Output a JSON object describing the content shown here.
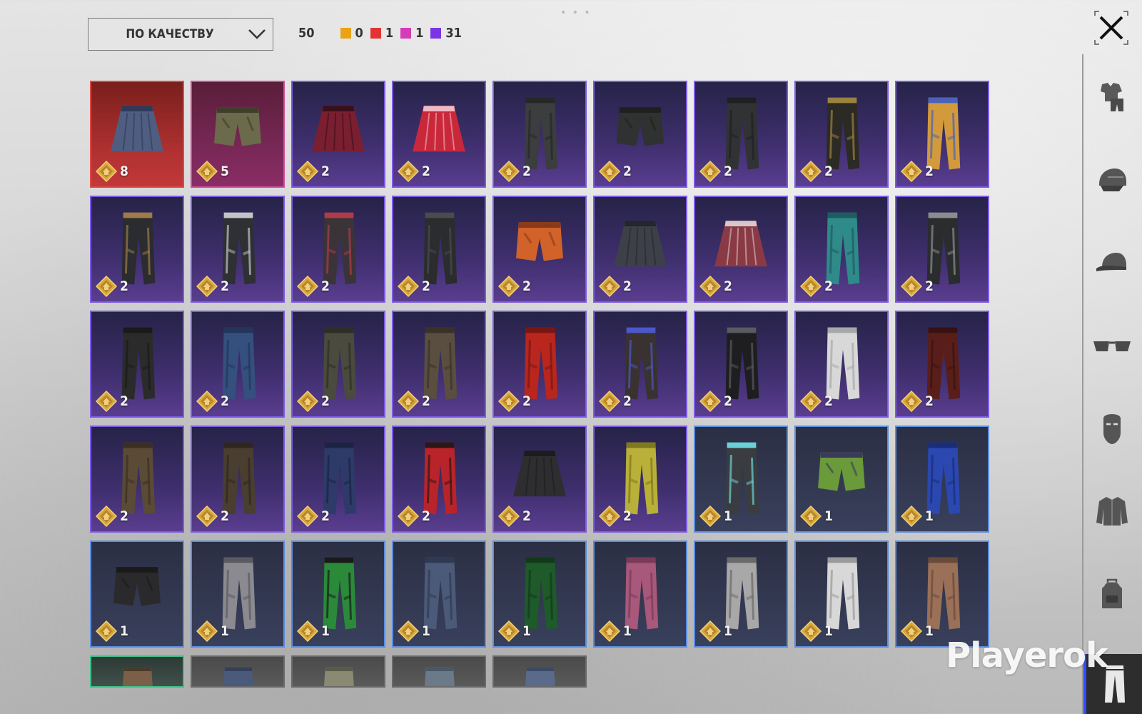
{
  "toolbar": {
    "sort_label": "ПО КАЧЕСТВУ",
    "total": "50",
    "rarity_counts": [
      {
        "color": "#e8a317",
        "count": "0"
      },
      {
        "color": "#e23434",
        "count": "1"
      },
      {
        "color": "#d43cb8",
        "count": "1"
      },
      {
        "color": "#7b35e6",
        "count": "31"
      }
    ]
  },
  "items": [
    {
      "label": "8",
      "rarity": "red",
      "kind": "skirt",
      "colors": [
        "#4f5d80",
        "#2e3a58"
      ]
    },
    {
      "label": "5",
      "rarity": "pink",
      "kind": "shorts",
      "colors": [
        "#6b6a4a",
        "#3e3e2a"
      ]
    },
    {
      "label": "2",
      "rarity": "purple",
      "kind": "skirt",
      "colors": [
        "#7a1f30",
        "#3a0f1a"
      ]
    },
    {
      "label": "2",
      "rarity": "purple",
      "kind": "skirt",
      "colors": [
        "#c9283a",
        "#f0b8c2"
      ]
    },
    {
      "label": "2",
      "rarity": "purple",
      "kind": "pants",
      "colors": [
        "#3b3d3e",
        "#262828"
      ]
    },
    {
      "label": "2",
      "rarity": "purple",
      "kind": "shorts",
      "colors": [
        "#2f3230",
        "#1e201f"
      ]
    },
    {
      "label": "2",
      "rarity": "purple",
      "kind": "pants",
      "colors": [
        "#303234",
        "#1e2022"
      ]
    },
    {
      "label": "2",
      "rarity": "purple",
      "kind": "pants",
      "colors": [
        "#2c2a24",
        "#9a8240"
      ]
    },
    {
      "label": "2",
      "rarity": "purple",
      "kind": "pants",
      "colors": [
        "#d39a3c",
        "#4a63b8"
      ]
    },
    {
      "label": "2",
      "rarity": "purple",
      "kind": "pants",
      "colors": [
        "#2a2c30",
        "#a07a48"
      ]
    },
    {
      "label": "2",
      "rarity": "purple",
      "kind": "pants",
      "colors": [
        "#2e3034",
        "#c4c4c8"
      ]
    },
    {
      "label": "2",
      "rarity": "purple",
      "kind": "pants",
      "colors": [
        "#3a3438",
        "#b03a4a"
      ]
    },
    {
      "label": "2",
      "rarity": "purple",
      "kind": "pants",
      "colors": [
        "#2b2c2e",
        "#4a4b4e"
      ]
    },
    {
      "label": "2",
      "rarity": "purple",
      "kind": "shorts",
      "colors": [
        "#d0622a",
        "#8a3a18"
      ]
    },
    {
      "label": "2",
      "rarity": "purple",
      "kind": "skirt",
      "colors": [
        "#3d4048",
        "#23262c"
      ]
    },
    {
      "label": "2",
      "rarity": "purple",
      "kind": "skirt",
      "colors": [
        "#8a3a44",
        "#d8c8c8"
      ]
    },
    {
      "label": "2",
      "rarity": "purple",
      "kind": "pants",
      "colors": [
        "#2f8a8a",
        "#1e5c60"
      ]
    },
    {
      "label": "2",
      "rarity": "purple",
      "kind": "pants",
      "colors": [
        "#2a2c2e",
        "#8a8c90"
      ]
    },
    {
      "label": "2",
      "rarity": "purple",
      "kind": "pants",
      "colors": [
        "#2b2b2b",
        "#1a1a1a"
      ]
    },
    {
      "label": "2",
      "rarity": "purple",
      "kind": "pants",
      "colors": [
        "#35507e",
        "#22365a"
      ]
    },
    {
      "label": "2",
      "rarity": "purple",
      "kind": "pants",
      "colors": [
        "#4a4a3e",
        "#2e2e26"
      ]
    },
    {
      "label": "2",
      "rarity": "purple",
      "kind": "pants",
      "colors": [
        "#5a4e40",
        "#3a3228"
      ]
    },
    {
      "label": "2",
      "rarity": "purple",
      "kind": "pants",
      "colors": [
        "#b8261e",
        "#7a1612"
      ]
    },
    {
      "label": "2",
      "rarity": "purple",
      "kind": "pants",
      "colors": [
        "#3a3230",
        "#4a58c8"
      ]
    },
    {
      "label": "2",
      "rarity": "purple",
      "kind": "pants",
      "colors": [
        "#1e1e20",
        "#5a5a60"
      ]
    },
    {
      "label": "2",
      "rarity": "purple",
      "kind": "pants",
      "colors": [
        "#d8d8d8",
        "#a8a8aa"
      ]
    },
    {
      "label": "2",
      "rarity": "purple",
      "kind": "pants",
      "colors": [
        "#5a1e1a",
        "#381210"
      ]
    },
    {
      "label": "2",
      "rarity": "purple",
      "kind": "pants",
      "colors": [
        "#5a4a36",
        "#3a3022"
      ]
    },
    {
      "label": "2",
      "rarity": "purple",
      "kind": "pants",
      "colors": [
        "#4a3e30",
        "#2e2620"
      ]
    },
    {
      "label": "2",
      "rarity": "purple",
      "kind": "pants",
      "colors": [
        "#2e3a68",
        "#1c2444"
      ]
    },
    {
      "label": "2",
      "rarity": "purple",
      "kind": "pants",
      "colors": [
        "#b8242a",
        "#2a1818"
      ]
    },
    {
      "label": "2",
      "rarity": "purple",
      "kind": "skirt",
      "colors": [
        "#2e2e30",
        "#1c1c1e"
      ]
    },
    {
      "label": "2",
      "rarity": "purple",
      "kind": "pants",
      "colors": [
        "#b8b038",
        "#7e7820"
      ]
    },
    {
      "label": "1",
      "rarity": "blue",
      "kind": "pants",
      "colors": [
        "#3a3c40",
        "#6ad0d8"
      ]
    },
    {
      "label": "1",
      "rarity": "blue",
      "kind": "shorts",
      "colors": [
        "#6a9a3a",
        "#3a3a5a"
      ]
    },
    {
      "label": "1",
      "rarity": "blue",
      "kind": "pants",
      "colors": [
        "#2a48b0",
        "#1a2e78"
      ]
    },
    {
      "label": "1",
      "rarity": "blue",
      "kind": "shorts",
      "colors": [
        "#2a2a2c",
        "#1a1a1c"
      ]
    },
    {
      "label": "1",
      "rarity": "blue",
      "kind": "pants",
      "colors": [
        "#8a8a90",
        "#5a5a60"
      ]
    },
    {
      "label": "1",
      "rarity": "blue",
      "kind": "pants",
      "colors": [
        "#2a8a3a",
        "#1a1a1a"
      ]
    },
    {
      "label": "1",
      "rarity": "blue",
      "kind": "pants",
      "colors": [
        "#4a5a78",
        "#2e3a52"
      ]
    },
    {
      "label": "1",
      "rarity": "blue",
      "kind": "pants",
      "colors": [
        "#1e5a2a",
        "#123a1a"
      ]
    },
    {
      "label": "1",
      "rarity": "blue",
      "kind": "pants",
      "colors": [
        "#a8587a",
        "#7a3a58"
      ]
    },
    {
      "label": "1",
      "rarity": "blue",
      "kind": "pants",
      "colors": [
        "#a8a8a8",
        "#6a6a6a"
      ]
    },
    {
      "label": "1",
      "rarity": "blue",
      "kind": "pants",
      "colors": [
        "#d8d8d8",
        "#9a9a9a"
      ]
    },
    {
      "label": "1",
      "rarity": "blue",
      "kind": "pants",
      "colors": [
        "#9a7058",
        "#6a4a38"
      ]
    }
  ],
  "partial_items": [
    {
      "rarity": "green",
      "colors": [
        "#7a6048",
        "#4a3a2a"
      ]
    },
    {
      "rarity": "gray",
      "colors": [
        "#4a5a7a",
        "#34405a"
      ]
    },
    {
      "rarity": "gray",
      "colors": [
        "#8a8a72",
        "#5a5a4a"
      ]
    },
    {
      "rarity": "gray",
      "colors": [
        "#6a7a88",
        "#4a5866"
      ]
    },
    {
      "rarity": "gray",
      "colors": [
        "#5a6a8a",
        "#3a4a66"
      ]
    }
  ],
  "sidebar": {
    "categories": [
      {
        "name": "outfit-icon"
      },
      {
        "name": "helmet-icon"
      },
      {
        "name": "cap-icon"
      },
      {
        "name": "glasses-icon"
      },
      {
        "name": "mask-icon"
      },
      {
        "name": "jacket-icon"
      },
      {
        "name": "backpack-icon"
      }
    ],
    "active": "pants-icon"
  },
  "watermark": "Playerok"
}
